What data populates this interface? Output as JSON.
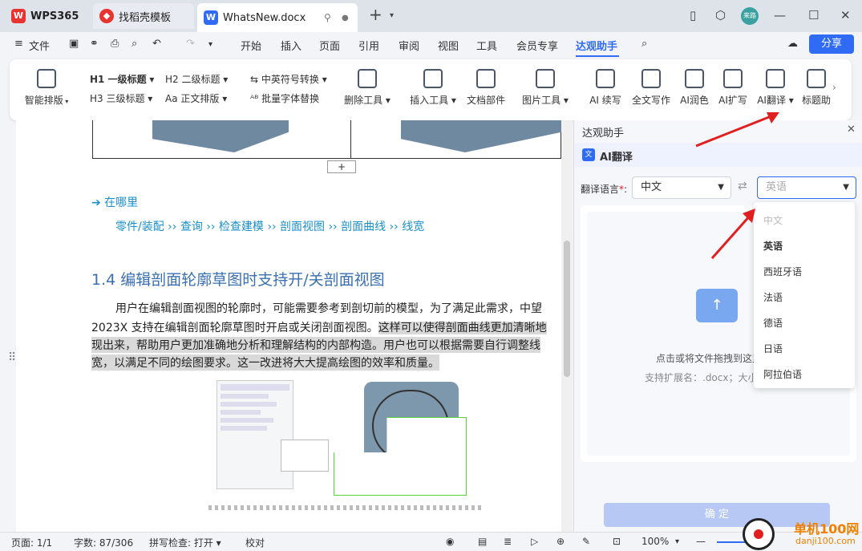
{
  "titlebar": {
    "tabs": [
      {
        "label": "WPS365"
      },
      {
        "label": "找稻壳模板"
      },
      {
        "label": "WhatsNew.docx"
      }
    ],
    "user": "来路"
  },
  "menu": {
    "file": "文件",
    "items": [
      "开始",
      "插入",
      "页面",
      "引用",
      "审阅",
      "视图",
      "工具",
      "会员专享",
      "达观助手"
    ],
    "share": "分享"
  },
  "ribbon": {
    "smart_layout": "智能排版",
    "h1": "H1 一级标题",
    "h2": "H2 二级标题",
    "h3": "H3 三级标题",
    "body": "Aa 正文排版",
    "cn_en": "中英符号转换",
    "batch_font": "批量字体替换",
    "delete_tool": "删除工具",
    "insert_tool": "插入工具",
    "doc_parts": "文档部件",
    "image_tool": "图片工具",
    "ai_continue": "AI 续写",
    "full_write": "全文写作",
    "ai_polish": "AI润色",
    "ai_expand": "AI扩写",
    "ai_translate": "AI翻译",
    "title_gen": "标题助"
  },
  "doc": {
    "where": "➔ 在哪里",
    "path": "零件/装配 ›› 查询 ›› 检查建模 ›› 剖面视图 ›› 剖面曲线 ›› 线宽",
    "heading": "1.4 编辑剖面轮廓草图时支持开/关剖面视图",
    "p1": "用户在编辑剖面视图的轮廓时，可能需要参考到剖切前的模型，为了满足此需求，中望",
    "p2a": "2023X 支持在编辑剖面轮廓草图时开启或关闭剖面视图。",
    "p2b": "这样可以使得剖面曲线更加清晰地",
    "p3": "现出来，帮助用户更加准确地分析和理解结构的内部构造。用户也可以根据需要自行调整线",
    "p4": "宽，以满足不同的绘图要求。这一改进将大大提高绘图的效率和质量。",
    "add": "+"
  },
  "panel": {
    "title": "达观助手",
    "section": "AI翻译",
    "lang_label": "翻译语言",
    "required": "*",
    "src_lang": "中文",
    "tgt_placeholder": "英语",
    "upload_text": "点击或将文件拖拽到这里",
    "ext_text": "支持扩展名：.docx；大小",
    "options": [
      "中文",
      "英语",
      "西班牙语",
      "法语",
      "德语",
      "日语",
      "阿拉伯语"
    ],
    "confirm": "确 定"
  },
  "status": {
    "page": "页面: 1/1",
    "words": "字数: 87/306",
    "spell": "拼写检查: 打开",
    "proof": "校对",
    "zoom": "100%"
  },
  "watermark": {
    "site": "单机100网",
    "url": "danji100.com"
  },
  "colors": {
    "accent": "#2f6bf5",
    "link": "#1a8fc8",
    "arrow": "#e02020"
  }
}
